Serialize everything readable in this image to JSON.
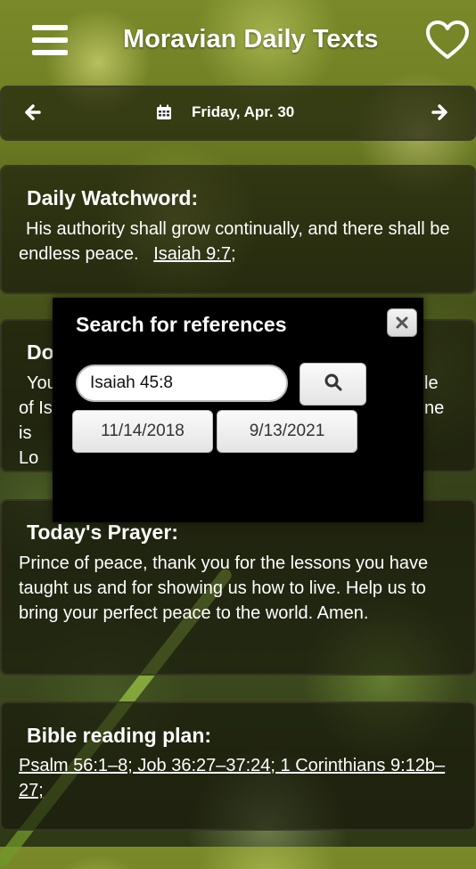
{
  "header": {
    "title": "Moravian Daily Texts",
    "menu_icon": "hamburger-menu-icon",
    "favorite_icon": "heart-icon"
  },
  "datebar": {
    "prev_icon": "arrow-left-icon",
    "calendar_icon": "calendar-icon",
    "date": "Friday, Apr. 30",
    "next_icon": "arrow-right-icon"
  },
  "watchword": {
    "title": "Daily Watchword:",
    "text": "His authority shall grow continually, and there shall be endless peace.",
    "reference": "Isaiah 9:7;"
  },
  "doctrinal": {
    "title": "Doctrinal Text:",
    "fragments": [
      "You",
      "of Is",
      "is Lo",
      "le",
      "ne"
    ]
  },
  "prayer": {
    "title": "Today's Prayer:",
    "text": "Prince of peace, thank you for the lessons you have taught us and for showing us how to live. Help us to bring your perfect peace to the world. Amen."
  },
  "reading_plan": {
    "title": "Bible reading plan:",
    "references": "Psalm 56:1–8; Job 36:27–37:24; 1 Corinthians 9:12b–27;"
  },
  "search_dialog": {
    "title": "Search for references",
    "close_icon": "close-icon",
    "search_value": "Isaiah 45:8",
    "search_icon": "search-icon",
    "date_from": "11/14/2018",
    "date_to": "9/13/2021"
  },
  "colors": {
    "panel_bg": "#141408",
    "dialog_bg": "#000000",
    "text": "#ffffff"
  }
}
